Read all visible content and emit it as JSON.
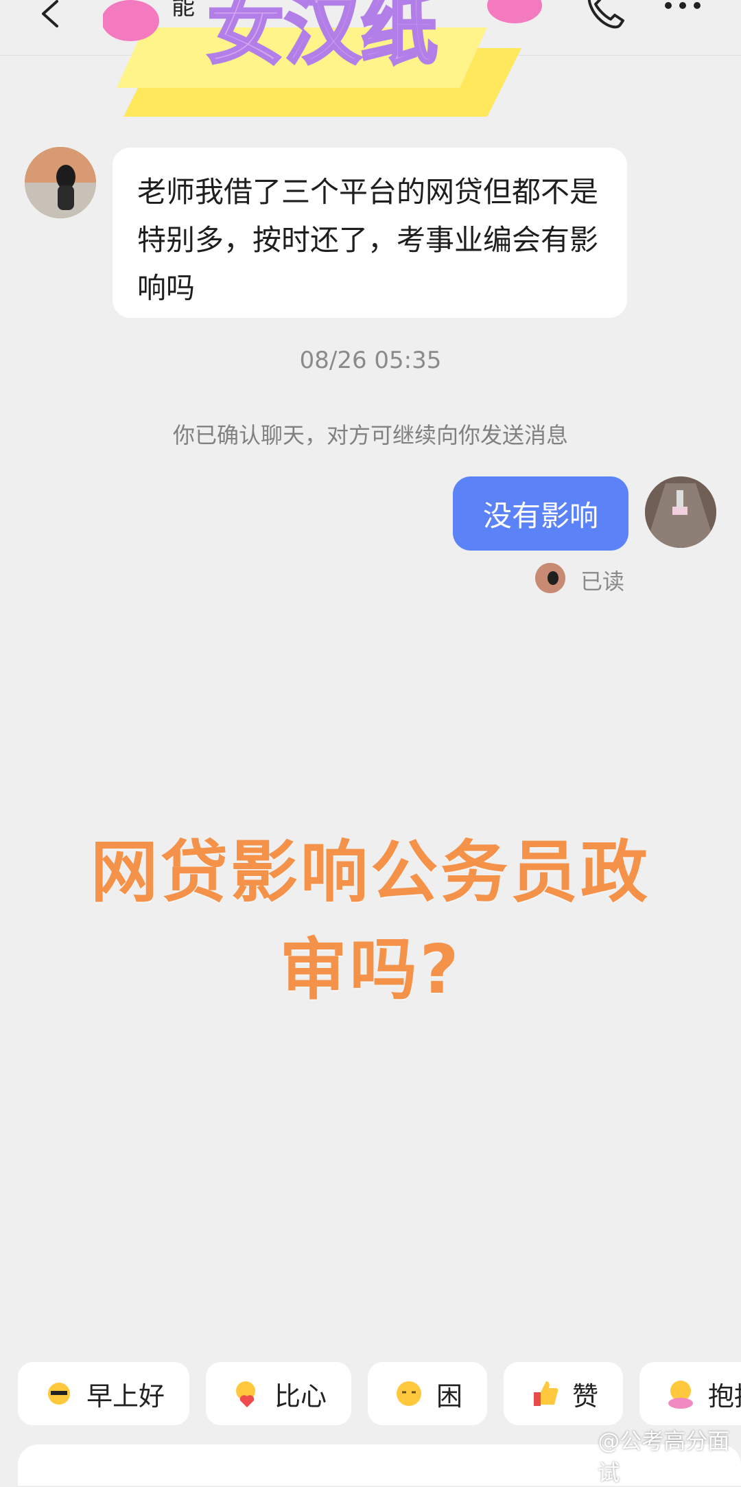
{
  "header": {
    "title": "能",
    "sticker_text": "女汉纸"
  },
  "chat": {
    "incoming_message": "老师我借了三个平台的网贷但都不是特别多，按时还了，考事业编会有影响吗",
    "timestamp": "08/26 05:35",
    "system_notice": "你已确认聊天，对方可继续向你发送消息",
    "outgoing_message": "没有影响",
    "read_status": "已读"
  },
  "overlay": {
    "caption_line1": "网贷影响公务员政",
    "caption_line2": "审吗?"
  },
  "quick_replies": [
    {
      "label": "早上好",
      "icon": "sun-sunglasses-icon"
    },
    {
      "label": "比心",
      "icon": "heart-hands-icon"
    },
    {
      "label": "困",
      "icon": "sleepy-face-icon"
    },
    {
      "label": "赞",
      "icon": "thumbs-up-icon"
    },
    {
      "label": "抱抱",
      "icon": "hug-icon"
    }
  ],
  "watermark": "@公考高分面试",
  "colors": {
    "background": "#efefef",
    "outgoing_bubble": "#5b83f7",
    "caption": "#f5924a"
  }
}
